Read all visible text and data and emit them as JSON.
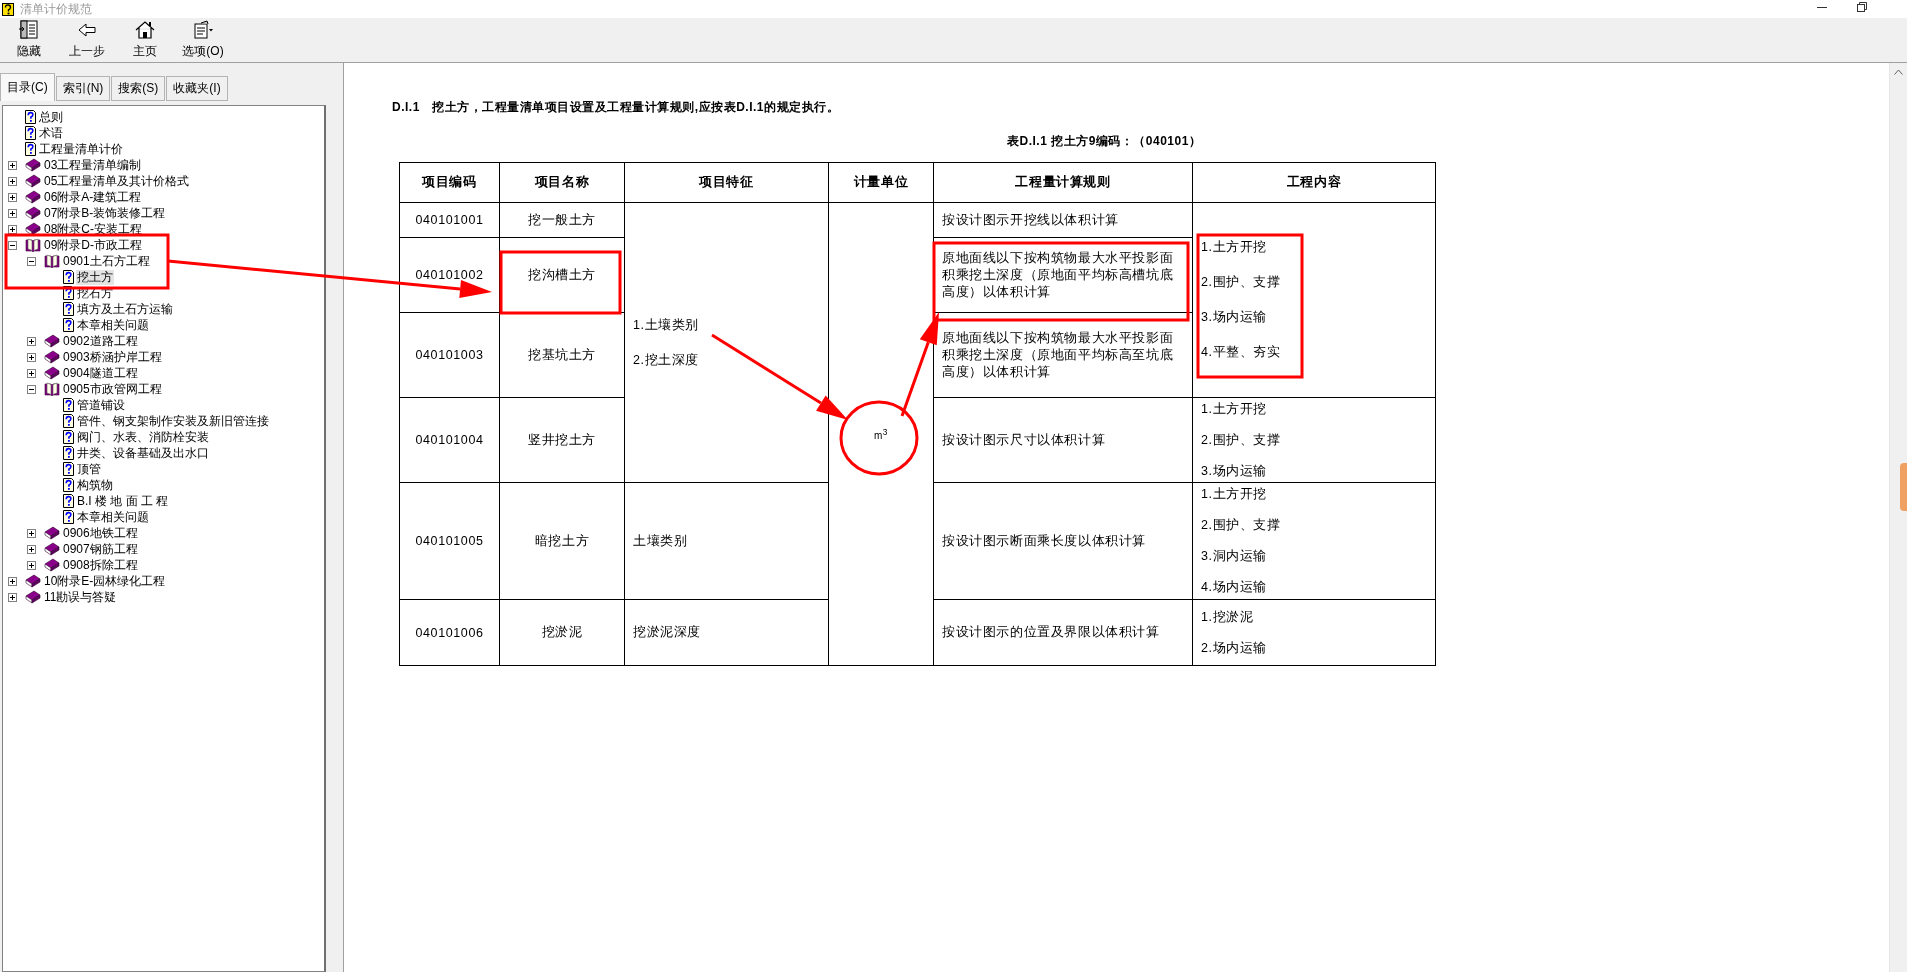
{
  "window": {
    "title": "清单计价规范"
  },
  "toolbar": [
    {
      "kind": "hide",
      "label": "隐藏"
    },
    {
      "kind": "back",
      "label": "上一步"
    },
    {
      "kind": "home",
      "label": "主页"
    },
    {
      "kind": "options",
      "label": "选项(O)"
    }
  ],
  "tabs": [
    {
      "label": "目录(C)",
      "selected": true
    },
    {
      "label": "索引(N)",
      "selected": false
    },
    {
      "label": "搜索(S)",
      "selected": false
    },
    {
      "label": "收藏夹(I)",
      "selected": false
    }
  ],
  "tree": [
    {
      "kind": "page",
      "label": "总则",
      "selected": false
    },
    {
      "kind": "page",
      "label": "术语",
      "selected": false
    },
    {
      "kind": "page",
      "label": "工程量清单计价",
      "selected": false
    },
    {
      "kind": "book",
      "label": "03工程量清单编制",
      "expanded": false,
      "selected": false
    },
    {
      "kind": "book",
      "label": "05工程量清单及其计价格式",
      "expanded": false,
      "selected": false
    },
    {
      "kind": "book",
      "label": "06附录A-建筑工程",
      "expanded": false,
      "selected": false
    },
    {
      "kind": "book",
      "label": "07附录B-装饰装修工程",
      "expanded": false,
      "selected": false
    },
    {
      "kind": "book",
      "label": "08附录C-安装工程",
      "expanded": false,
      "selected": false
    },
    {
      "kind": "book",
      "label": "09附录D-市政工程",
      "expanded": true,
      "selected": false,
      "children": [
        {
          "kind": "book",
          "label": "0901土石方工程",
          "expanded": true,
          "selected": false,
          "children": [
            {
              "kind": "page",
              "label": "挖土方",
              "selected": true
            },
            {
              "kind": "page",
              "label": "挖石方",
              "selected": false
            },
            {
              "kind": "page",
              "label": "填方及土石方运输",
              "selected": false
            },
            {
              "kind": "page",
              "label": "本章相关问题",
              "selected": false
            }
          ]
        },
        {
          "kind": "book",
          "label": "0902道路工程",
          "expanded": false,
          "selected": false
        },
        {
          "kind": "book",
          "label": "0903桥涵护岸工程",
          "expanded": false,
          "selected": false
        },
        {
          "kind": "book",
          "label": "0904隧道工程",
          "expanded": false,
          "selected": false
        },
        {
          "kind": "book",
          "label": "0905市政管网工程",
          "expanded": true,
          "selected": false,
          "children": [
            {
              "kind": "page",
              "label": "管道铺设",
              "selected": false
            },
            {
              "kind": "page",
              "label": "管件、钢支架制作安装及新旧管连接",
              "selected": false
            },
            {
              "kind": "page",
              "label": "阀门、水表、消防栓安装",
              "selected": false
            },
            {
              "kind": "page",
              "label": "井类、设备基础及出水口",
              "selected": false
            },
            {
              "kind": "page",
              "label": "顶管",
              "selected": false
            },
            {
              "kind": "page",
              "label": "构筑物",
              "selected": false
            },
            {
              "kind": "page",
              "label": "B.I 楼 地 面 工 程",
              "selected": false
            },
            {
              "kind": "page",
              "label": "本章相关问题",
              "selected": false
            }
          ]
        },
        {
          "kind": "book",
          "label": "0906地铁工程",
          "expanded": false,
          "selected": false
        },
        {
          "kind": "book",
          "label": "0907钢筋工程",
          "expanded": false,
          "selected": false
        },
        {
          "kind": "book",
          "label": "0908拆除工程",
          "expanded": false,
          "selected": false
        }
      ]
    },
    {
      "kind": "book",
      "label": "10附录E-园林绿化工程",
      "expanded": false,
      "selected": false
    },
    {
      "kind": "book",
      "label": "11勘误与答疑",
      "expanded": false,
      "selected": false
    }
  ],
  "content": {
    "heading": "D.I.1　挖土方，工程量清单项目设置及工程量计算规则,应按表D.I.1的规定执行。",
    "caption": "表D.I.1 挖土方9编码：（040101）",
    "table": {
      "columns": [
        "项目编码",
        "项目名称",
        "项目特征",
        "计量单位",
        "工程量计算规则",
        "工程内容"
      ],
      "rows": [
        {
          "code": "040101001",
          "name": "挖一般土方",
          "feature": [
            "1.土壤类别",
            "2.挖土深度"
          ],
          "unit": "m$^{3}$",
          "rule": "按设计图示开挖线以体积计算",
          "content": [
            "1.土方开挖",
            "2.围护、支撑",
            "3.场内运输",
            "4.平整、夯实"
          ]
        },
        {
          "code": "040101002",
          "name": "挖沟槽土方",
          "rule": "原地面线以下按构筑物最大水平投影面积乘挖土深度（原地面平均标高槽坑底高度）以体积计算"
        },
        {
          "code": "040101003",
          "name": "挖基坑土方",
          "rule": "原地面线以下按构筑物最大水平投影面积乘挖土深度（原地面平均标高至坑底高度）以体积计算"
        },
        {
          "code": "040101004",
          "name": "竖井挖土方",
          "rule": "按设计图示尺寸以体积计算",
          "content": [
            "1.土方开挖",
            "2.围护、支撑",
            "3.场内运输"
          ]
        },
        {
          "code": "040101005",
          "name": "暗挖土方",
          "feature": [
            "土壤类别"
          ],
          "rule": "按设计图示断面乘长度以体积计算",
          "content": [
            "1.土方开挖",
            "2.围护、支撑",
            "3.洞内运输",
            "4.场内运输"
          ]
        },
        {
          "code": "040101006",
          "name": "挖淤泥",
          "feature": [
            "挖淤泥深度"
          ],
          "rule": "按设计图示的位置及界限以体积计算",
          "content": [
            "1.挖淤泥",
            "2.场内运输"
          ]
        }
      ]
    }
  }
}
